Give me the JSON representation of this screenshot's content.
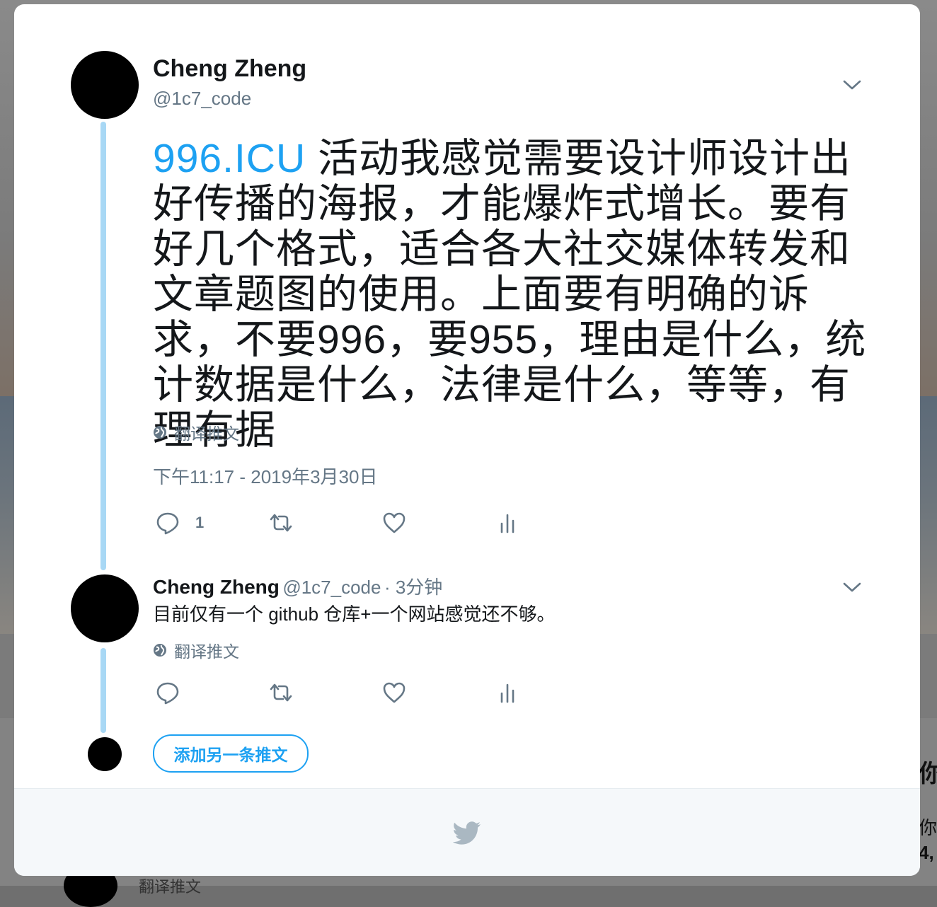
{
  "colors": {
    "accent": "#1da1f2",
    "thread_line": "#a8d8f5",
    "text_primary": "#14171a",
    "text_secondary": "#657786"
  },
  "main_tweet": {
    "author_name": "Cheng Zheng",
    "author_handle": "@1c7_code",
    "link_text": "996.ICU",
    "body_text": " 活动我感觉需要设计师设计出好传播的海报，才能爆炸式增长。要有好几个格式，适合各大社交媒体转发和文章题图的使用。上面要有明确的诉求，不要996，要955，理由是什么，统计数据是什么，法律是什么，等等，有理有据",
    "translate_label": "翻译推文",
    "timestamp": "下午11:17 - 2019年3月30日",
    "reply_count": "1",
    "icons": [
      "reply-icon",
      "retweet-icon",
      "like-icon",
      "analytics-icon",
      "chevron-down-icon",
      "globe-icon"
    ]
  },
  "reply_tweet": {
    "author_name": "Cheng Zheng",
    "author_handle": "@1c7_code",
    "time_ago": "· 3分钟",
    "body_text": "目前仅有一个 github 仓库+一个网站感觉还不够。",
    "translate_label": "翻译推文"
  },
  "compose": {
    "add_button_label": "添加另一条推文"
  },
  "background": {
    "side_text_1": "你",
    "side_text_2": "你的",
    "side_text_3": "4,",
    "bottom_text": "翻译推文"
  }
}
